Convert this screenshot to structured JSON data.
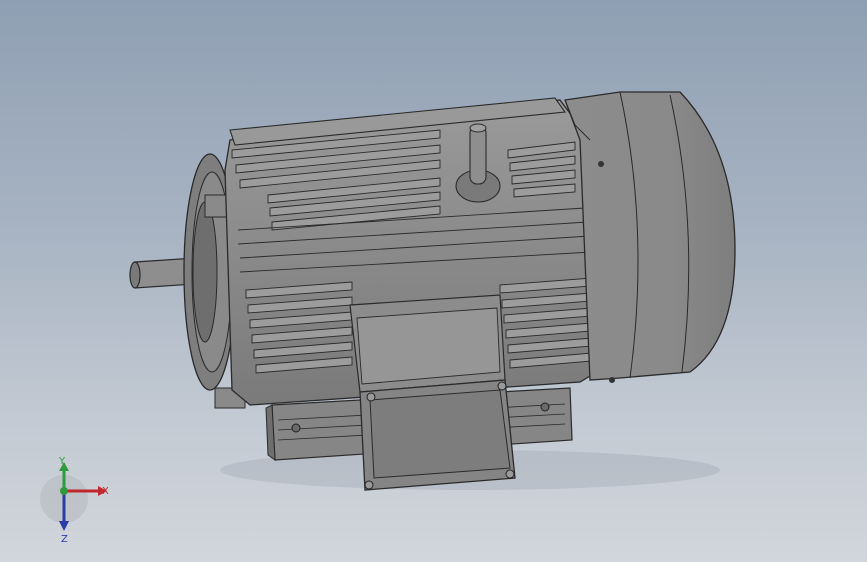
{
  "scene": {
    "background_top": "#8f9fb3",
    "background_bottom": "#d2d6dc",
    "model_color": "#8a8a8a",
    "model_edge": "#2a2a2a"
  },
  "triad": {
    "x_label": "X",
    "y_label": "Y",
    "z_label": "Z",
    "x_color": "#c0282d",
    "y_color": "#2e9a3a",
    "z_color": "#2b3ea8"
  }
}
